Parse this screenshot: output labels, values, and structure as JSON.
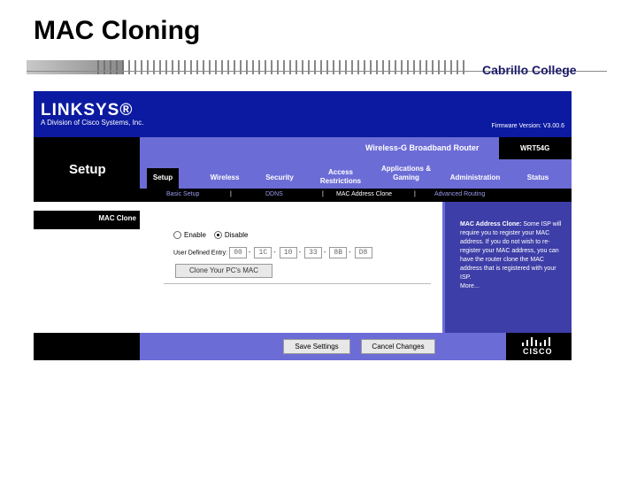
{
  "slide": {
    "title": "MAC Cloning",
    "college": "Cabrillo College"
  },
  "router": {
    "logo": "LINKSYS®",
    "logo_sub": "A Division of Cisco Systems, Inc.",
    "firmware": "Firmware Version: V3.00.6",
    "product_name": "Wireless-G Broadband Router",
    "model": "WRT54G",
    "page_title": "Setup",
    "tabs": [
      "Setup",
      "Wireless",
      "Security",
      "Access Restrictions",
      "Applications & Gaming",
      "Administration",
      "Status"
    ],
    "subtabs": [
      "Basic Setup",
      "|",
      "DDNS",
      "|",
      "MAC Address Clone",
      "|",
      "Advanced Routing"
    ],
    "section_label": "MAC Clone",
    "enable_label": "Enable",
    "disable_label": "Disable",
    "selected": "Disable",
    "entry_label": "User Defined Entry:",
    "mac_octets": [
      "00",
      "1C",
      "10",
      "33",
      "8B",
      "D8"
    ],
    "clone_button": "Clone Your PC's MAC",
    "help_title": "MAC Address Clone:",
    "help_text": "Some ISP will require you to register your MAC address. If you do not wish to re-register your MAC address, you can have the router clone the MAC address that is registered with your ISP.",
    "help_more": "More...",
    "save_button": "Save Settings",
    "cancel_button": "Cancel Changes",
    "cisco": "CISCO"
  },
  "colors": {
    "linksys_blue": "#0b1aa0",
    "nav_purple": "#6c6cd6",
    "help_blue": "#3e3ea8"
  }
}
